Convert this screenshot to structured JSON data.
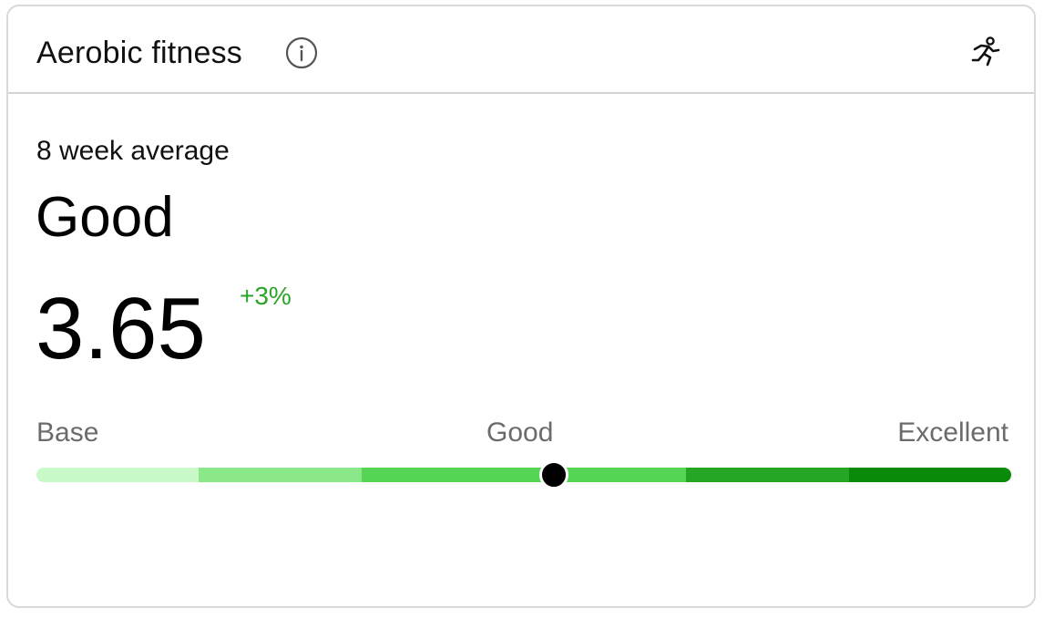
{
  "header": {
    "title": "Aerobic fitness",
    "info_icon": "info-circle-icon",
    "activity_icon": "running-person-icon"
  },
  "summary": {
    "period_label": "8 week average",
    "rating": "Good",
    "score": "3.65",
    "change": "+3%"
  },
  "scale": {
    "labels": {
      "low": "Base",
      "mid": "Good",
      "high": "Excellent"
    },
    "segment_colors": [
      "#c9f8c9",
      "#8ae88a",
      "#55d455",
      "#55d455",
      "#25a725",
      "#098a09"
    ],
    "marker_position": 0.53
  },
  "colors": {
    "accent_positive": "#2aa52a",
    "border": "#d9d9d9"
  }
}
